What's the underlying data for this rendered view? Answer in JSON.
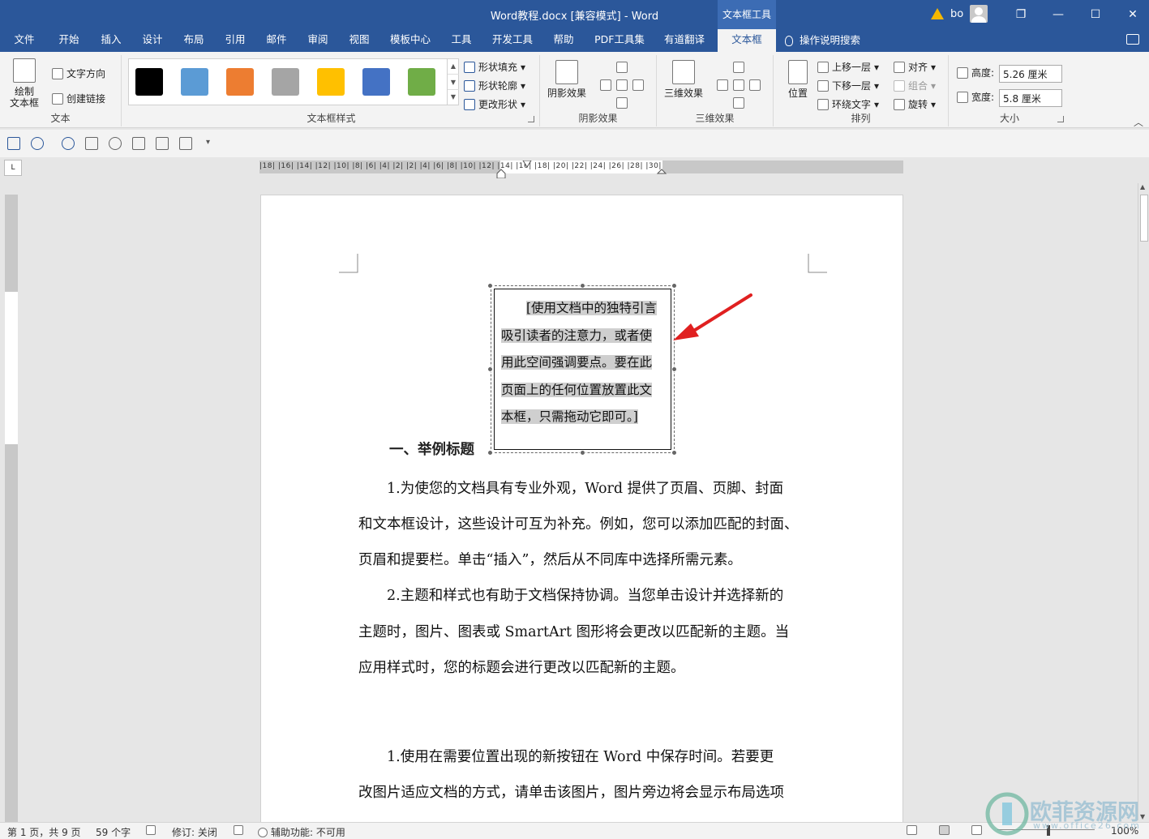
{
  "window": {
    "title": "Word教程.docx [兼容模式]  -  Word",
    "context_tab_title": "文本框工具",
    "user_name": "bo",
    "minimize": "—",
    "restore": "❐",
    "maximize": "☐",
    "close": "✕"
  },
  "tabs": [
    "文件",
    "开始",
    "插入",
    "设计",
    "布局",
    "引用",
    "邮件",
    "审阅",
    "视图",
    "模板中心",
    "工具",
    "开发工具",
    "帮助",
    "PDF工具集",
    "有道翻译",
    "文本框"
  ],
  "search_tab": "操作说明搜索",
  "ribbon": {
    "text_group": {
      "label": "文本",
      "draw_textbox": "绘制",
      "draw_textbox_2": "文本框",
      "text_direction": "文字方向",
      "create_link": "创建链接"
    },
    "style_group": {
      "label": "文本框样式",
      "swatches": [
        "#000000",
        "#5b9bd5",
        "#ed7d31",
        "#a5a5a5",
        "#ffc000",
        "#4472c4",
        "#70ad47"
      ],
      "shape_fill": "形状填充",
      "shape_outline": "形状轮廓",
      "change_shape": "更改形状"
    },
    "shadow_group": {
      "label": "阴影效果",
      "button": "阴影效果"
    },
    "threed_group": {
      "label": "三维效果",
      "button": "三维效果"
    },
    "arrange_group": {
      "label": "排列",
      "position": "位置",
      "bring_forward": "上移一层",
      "send_backward": "下移一层",
      "wrap_text": "环绕文字",
      "align": "对齐",
      "group": "组合",
      "rotate": "旋转"
    },
    "size_group": {
      "label": "大小",
      "height_label": "高度:",
      "height_value": "5.26 厘米",
      "width_label": "宽度:",
      "width_value": "5.8 厘米"
    }
  },
  "ruler": {
    "corner": "L",
    "numbers": "|18|  |16|  |14|  |12|  |10|  |8|  |6|  |4|  |2|      |2|  |4|  |6|  |8|  |10|  |12|  |14|  |16|  |18|  |20|  |22|  |24|  |26|  |28|  |30|"
  },
  "document": {
    "textbox_lines": [
      "[使用文档中的独特引言",
      "吸引读者的注意力，或者使",
      "用此空间强调要点。要在此",
      "页面上的任何位置放置此文",
      "本框，只需拖动它即可。]"
    ],
    "heading": "一、举例标题",
    "paragraphs": [
      "　　1.为使您的文档具有专业外观，Word 提供了页眉、页脚、封面",
      "和文本框设计，这些设计可互为补充。例如，您可以添加匹配的封面、",
      "页眉和提要栏。单击“插入”，然后从不同库中选择所需元素。",
      "　　2.主题和样式也有助于文档保持协调。当您单击设计并选择新的",
      "主题时，图片、图表或 SmartArt 图形将会更改以匹配新的主题。当",
      "应用样式时，您的标题会进行更改以匹配新的主题。",
      "　　1.使用在需要位置出现的新按钮在 Word 中保存时间。若要更",
      "改图片适应文档的方式，请单击该图片，图片旁边将会显示布局选项"
    ]
  },
  "status": {
    "page": "第 1 页，共 9 页",
    "words": "59 个字",
    "track": "修订: 关闭",
    "accessibility": "辅助功能: 不可用",
    "zoom": "100%"
  },
  "watermark": {
    "name": "欧菲资源网",
    "url": "www.office26.com"
  },
  "colors": {
    "accent": "#2b579a",
    "arrow": "#e02020"
  }
}
